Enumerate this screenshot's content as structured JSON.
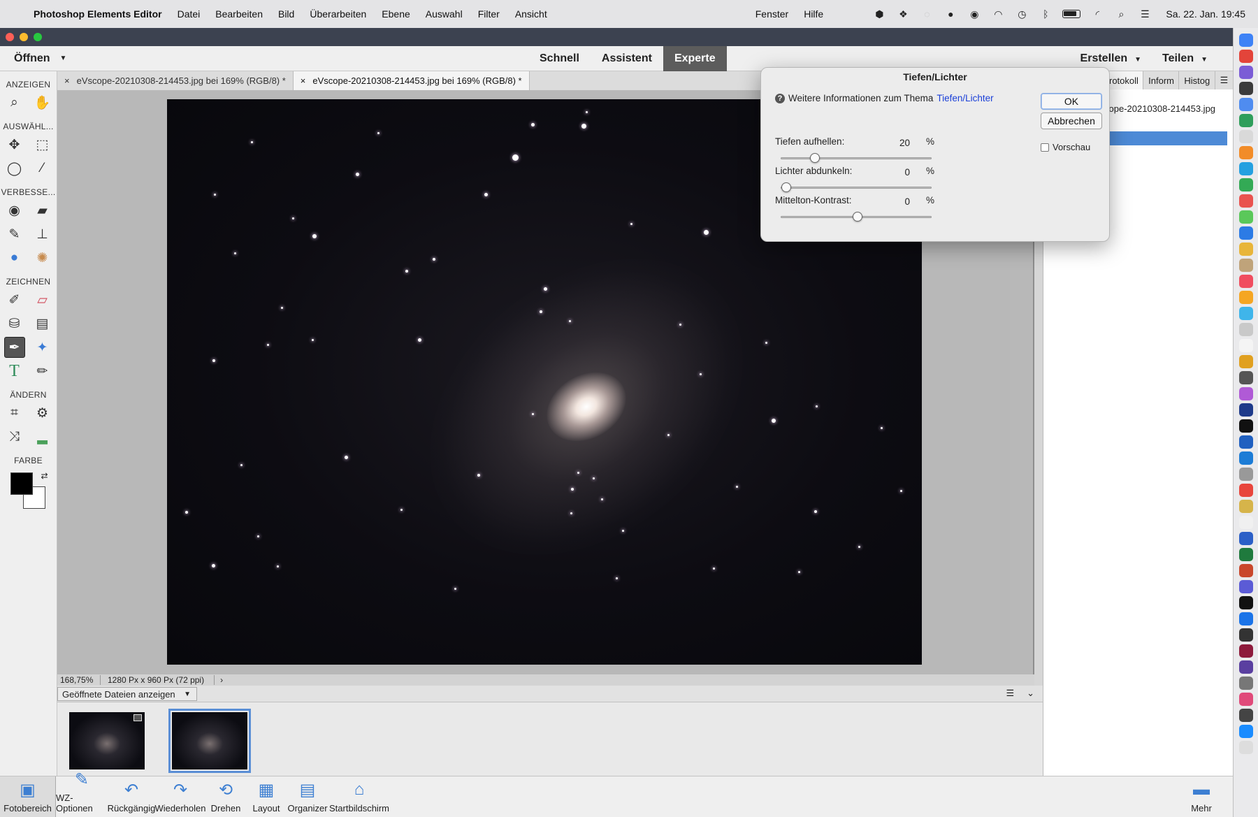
{
  "menubar": {
    "app_name": "Photoshop Elements Editor",
    "menus": [
      "Datei",
      "Bearbeiten",
      "Bild",
      "Überarbeiten",
      "Ebene",
      "Auswahl",
      "Filter",
      "Ansicht"
    ],
    "right_menus": [
      "Fenster",
      "Hilfe"
    ],
    "clock": "Sa. 22. Jan.  19:45"
  },
  "appbar": {
    "open_label": "Öffnen",
    "modes": [
      "Schnell",
      "Assistent",
      "Experte"
    ],
    "active_mode": "Experte",
    "create_label": "Erstellen",
    "share_label": "Teilen"
  },
  "toolbox": {
    "sections": {
      "view": "ANZEIGEN",
      "select": "AUSWÄHL...",
      "enhance": "VERBESSE...",
      "draw": "ZEICHNEN",
      "modify": "ÄNDERN",
      "color": "FARBE"
    }
  },
  "doc_tabs": [
    {
      "label": "eVscope-20210308-214453.jpg bei 169% (RGB/8) *",
      "active": false
    },
    {
      "label": "eVscope-20210308-214453.jpg bei 169% (RGB/8) *",
      "active": true
    }
  ],
  "statusbar": {
    "zoom": "168,75%",
    "dimensions": "1280 Px x 960 Px (72 ppi)",
    "arrow": "›"
  },
  "photo_bin": {
    "filter_label": "Geöffnete Dateien anzeigen"
  },
  "right_panel": {
    "tabs": [
      "rotokoll",
      "Inform",
      "Histog"
    ],
    "file_name": "cope-20210308-214453.jpg"
  },
  "taskbar": {
    "items": [
      "Fotobereich",
      "WZ-Optionen",
      "Rückgängig",
      "Wiederholen",
      "Drehen",
      "Layout",
      "Organizer",
      "Startbildschirm"
    ],
    "more_label": "Mehr"
  },
  "dialog": {
    "title": "Tiefen/Lichter",
    "info_text": "Weitere Informationen zum Thema",
    "info_link": "Tiefen/Lichter",
    "ok_label": "OK",
    "cancel_label": "Abbrechen",
    "preview_label": "Vorschau",
    "preview_checked": false,
    "sliders": [
      {
        "label": "Tiefen aufhellen:",
        "value": "20",
        "unit": "%",
        "min": 0,
        "max": 100,
        "position": 0.2
      },
      {
        "label": "Lichter abdunkeln:",
        "value": "0",
        "unit": "%",
        "min": 0,
        "max": 100,
        "position": 0
      },
      {
        "label": "Mittelton-Kontrast:",
        "value": "0",
        "unit": "%",
        "min": -100,
        "max": 100,
        "position": 0.5
      }
    ]
  }
}
